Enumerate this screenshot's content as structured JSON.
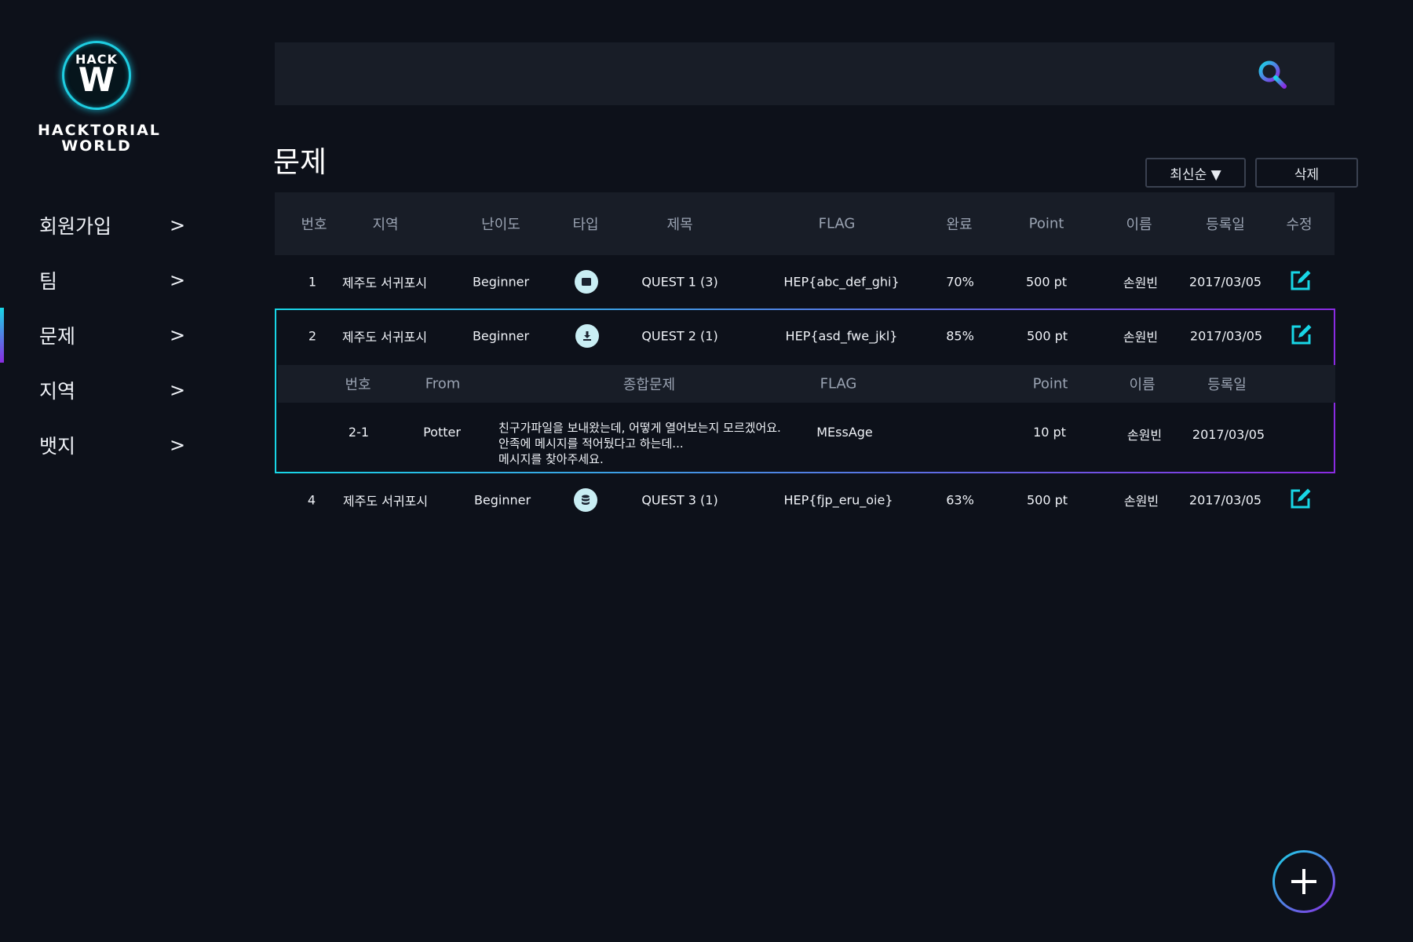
{
  "brand": {
    "badge_top": "HACK",
    "badge_letter": "W",
    "name": "HACKTORIAL WORLD"
  },
  "sidebar": {
    "items": [
      {
        "label": "회원가입",
        "chevron": ">"
      },
      {
        "label": "팀",
        "chevron": ">"
      },
      {
        "label": "문제",
        "chevron": ">",
        "active": true
      },
      {
        "label": "지역",
        "chevron": ">"
      },
      {
        "label": "뱃지",
        "chevron": ">"
      }
    ]
  },
  "search": {
    "icon": "search-icon"
  },
  "page": {
    "title": "문제"
  },
  "controls": {
    "sort_label": "최신순 ▼",
    "delete_label": "삭제"
  },
  "table": {
    "headers": [
      "번호",
      "지역",
      "난이도",
      "타입",
      "제목",
      "FLAG",
      "완료",
      "Point",
      "이름",
      "등록일",
      "수정"
    ],
    "rows": [
      {
        "no": "1",
        "region": "제주도 서귀포시",
        "difficulty": "Beginner",
        "type_icon": "file-icon",
        "title": "QUEST 1  (3)",
        "flag": "HEP{abc_def_ghi}",
        "done": "70%",
        "point": "500 pt",
        "name": "손원빈",
        "date": "2017/03/05"
      },
      {
        "no": "2",
        "region": "제주도 서귀포시",
        "difficulty": "Beginner",
        "type_icon": "download-icon",
        "title": "QUEST 2  (1)",
        "flag": "HEP{asd_fwe_jkl}",
        "done": "85%",
        "point": "500 pt",
        "name": "손원빈",
        "date": "2017/03/05"
      },
      {
        "no": "4",
        "region": "제주도 서귀포시",
        "difficulty": "Beginner",
        "type_icon": "database-icon",
        "title": "QUEST 3  (1)",
        "flag": "HEP{fjp_eru_oie}",
        "done": "63%",
        "point": "500 pt",
        "name": "손원빈",
        "date": "2017/03/05"
      }
    ],
    "sub": {
      "headers": [
        "번호",
        "From",
        "종합문제",
        "FLAG",
        "Point",
        "이름",
        "등록일"
      ],
      "row": {
        "no": "2-1",
        "from": "Potter",
        "desc_lines": [
          "친구가파일을 보내왔는데, 어떻게 열어보는지 모르겠어요.",
          "안족에 메시지를 적어뒀다고 하는데...",
          "메시지를 찾아주세요."
        ],
        "flag": "MEssAge",
        "point": "10 pt",
        "name": "손원빈",
        "date": "2017/03/05"
      }
    }
  },
  "colors": {
    "accent_cyan": "#18d6e6",
    "accent_purple": "#8a2be2",
    "background": "#0d111a",
    "panel": "#181d27"
  }
}
